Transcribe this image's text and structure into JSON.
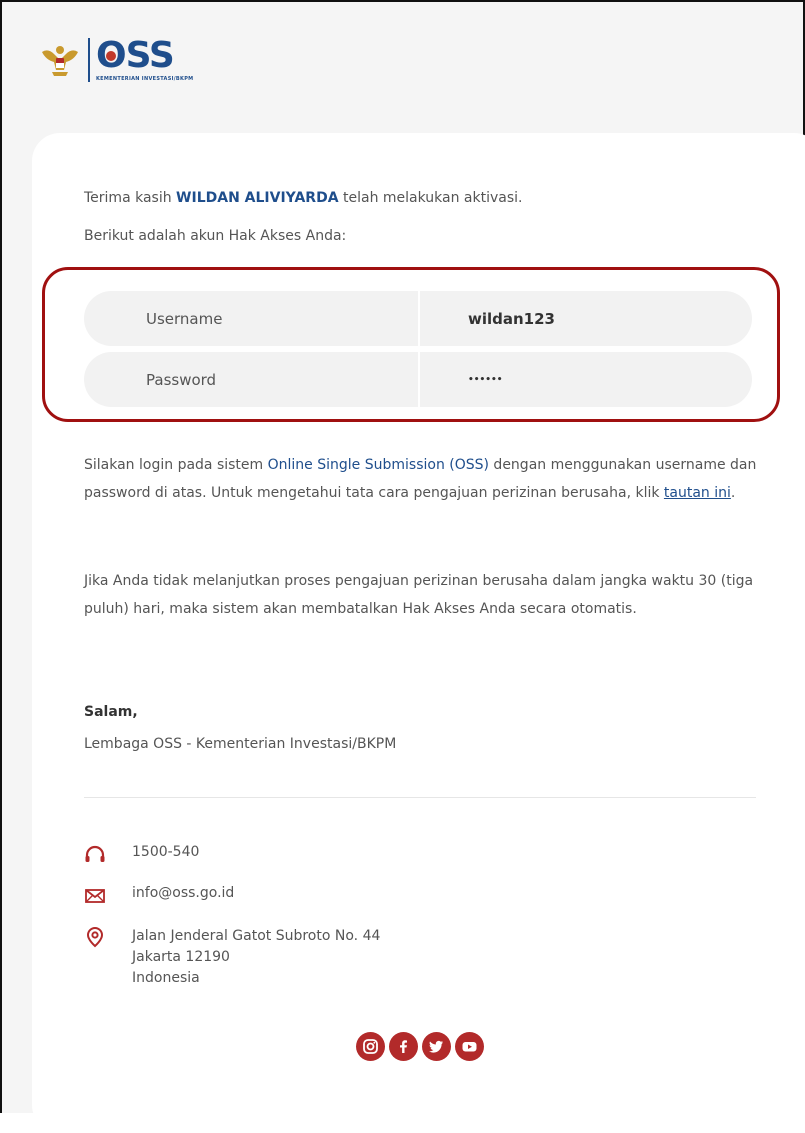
{
  "header": {
    "brand_text": "OSS",
    "brand_sub": "KEMENTERIAN INVESTASI/BKPM"
  },
  "message": {
    "intro_prefix": "Terima kasih ",
    "user_name": "WILDAN ALIVIYARDA",
    "intro_suffix": " telah melakukan aktivasi.",
    "intro_line2": "Berikut adalah akun Hak Akses Anda:"
  },
  "credentials": {
    "username_label": "Username",
    "username_value": "wildan123",
    "password_label": "Password",
    "password_value": "••••••"
  },
  "paragraph1": {
    "text_before": "Silakan login pada sistem ",
    "oss_link": "Online Single Submission (OSS)",
    "text_middle": " dengan menggunakan username dan password di atas. Untuk mengetahui tata cara pengajuan perizinan berusaha, klik ",
    "tautan_link": "tautan ini",
    "text_end": "."
  },
  "paragraph2": {
    "text": "Jika Anda tidak melanjutkan proses pengajuan perizinan berusaha dalam jangka waktu 30 (tiga puluh) hari, maka sistem akan membatalkan Hak Akses Anda secara otomatis."
  },
  "closing": {
    "salam": "Salam,",
    "org": "Lembaga OSS - Kementerian Investasi/BKPM"
  },
  "contact": {
    "phone": "1500-540",
    "email": "info@oss.go.id",
    "address_line1": "Jalan Jenderal Gatot Subroto No. 44",
    "address_line2": "Jakarta 12190",
    "address_line3": "Indonesia"
  },
  "social": {
    "icons": [
      "instagram-icon",
      "facebook-icon",
      "twitter-icon",
      "youtube-icon"
    ]
  },
  "colors": {
    "brand_blue": "#1f4e8c",
    "accent_red": "#b22a2a",
    "highlight_border": "#a01010"
  }
}
